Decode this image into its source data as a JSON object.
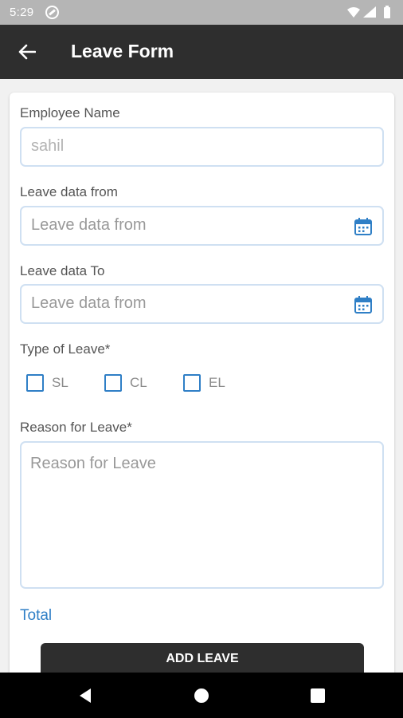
{
  "status_bar": {
    "time": "5:29",
    "icons": [
      "do-not-disturb-icon",
      "wifi-icon",
      "signal-icon",
      "battery-icon"
    ]
  },
  "app_bar": {
    "back_icon": "arrow-left-icon",
    "title": "Leave Form"
  },
  "form": {
    "employee_name": {
      "label": "Employee Name",
      "value": "sahil"
    },
    "leave_from": {
      "label": "Leave data from",
      "placeholder": "Leave data from",
      "icon": "calendar-icon"
    },
    "leave_to": {
      "label": "Leave data To",
      "placeholder": "Leave data from",
      "icon": "calendar-icon"
    },
    "leave_type": {
      "label": "Type of Leave*",
      "options": [
        {
          "label": "SL",
          "checked": false
        },
        {
          "label": "CL",
          "checked": false
        },
        {
          "label": "EL",
          "checked": false
        }
      ]
    },
    "reason": {
      "label": "Reason for Leave*",
      "placeholder": "Reason for Leave"
    },
    "total_label": "Total",
    "submit_label": "ADD LEAVE"
  },
  "nav_bar": {
    "buttons": [
      "back-triangle-icon",
      "home-circle-icon",
      "recents-square-icon"
    ]
  },
  "colors": {
    "app_bar": "#2e2e2e",
    "accent": "#2f7fc6",
    "input_border": "#cfe0f2",
    "status_bar": "#b5b5b5",
    "background": "#f1f1f1"
  }
}
